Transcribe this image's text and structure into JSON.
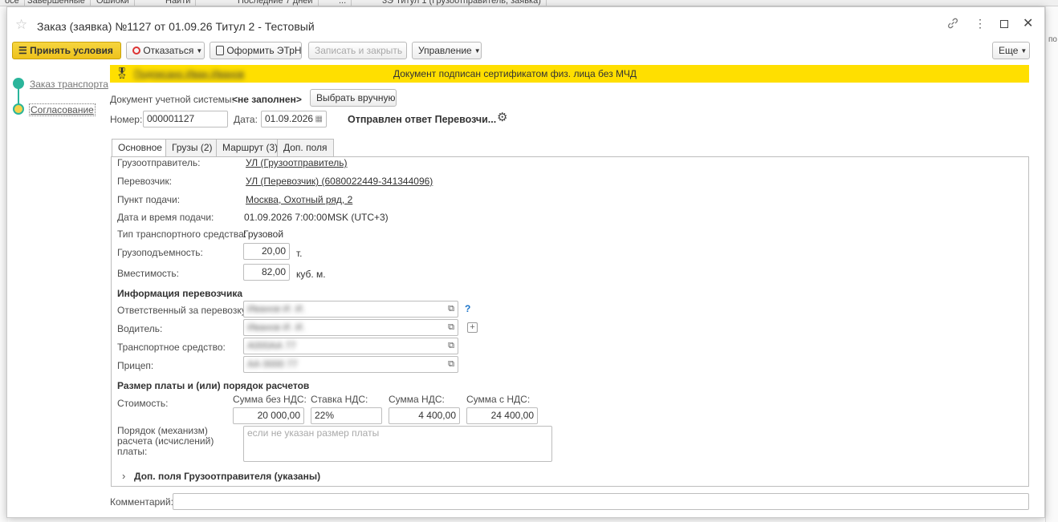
{
  "background": {
    "tabs": [
      "осе",
      "Завершенные",
      "Ошибки",
      "Найти",
      "Последние 7 дней",
      "...",
      "3Э Титул 1 (Грузоотправитель, заявка)"
    ],
    "right_fragment": "по"
  },
  "window": {
    "title": "Заказ (заявка) №1127 от 01.09.26 Титул 2 - Тестовый",
    "icons": [
      "star-icon",
      "link-icon",
      "more-icon",
      "maximize-icon",
      "close-icon"
    ]
  },
  "toolbar": {
    "accept": "Принять условия",
    "decline": "Отказаться",
    "etrn": "Оформить ЭТрН",
    "save_close": "Записать и закрыть",
    "manage": "Управление",
    "more": "Еще"
  },
  "steps": [
    {
      "label": "Заказ транспорта",
      "color": "#2bb59b"
    },
    {
      "label": "Согласование",
      "color": "#f5d24a"
    }
  ],
  "banner": {
    "signer": "Подписано Иван Иванов",
    "text": "Документ подписан сертификатом физ. лица без МЧД",
    "color": "#ffdf00"
  },
  "doc": {
    "label": "Документ учетной системы:",
    "value": "<не заполнен>",
    "button": "Выбрать вручную"
  },
  "header": {
    "number_label": "Номер:",
    "number": "000001127",
    "date_label": "Дата:",
    "date": "01.09.2026",
    "status": "Отправлен ответ Перевозчи..."
  },
  "tabs": [
    "Основное",
    "Грузы (2)",
    "Маршрут (3)",
    "Доп. поля"
  ],
  "main": {
    "shipper_label": "Грузоотправитель:",
    "shipper": "УЛ (Грузоотправитель)",
    "carrier_label": "Перевозчик:",
    "carrier": "УЛ (Перевозчик) (6080022449-341344096)",
    "pickup_label": "Пункт подачи:",
    "pickup": "Москва, Охотный ряд, 2",
    "datetime_label": "Дата и время подачи:",
    "datetime": "01.09.2026 7:00:00",
    "timezone": "MSK (UTC+3)",
    "vehicle_type_label": "Тип транспортного средства:",
    "vehicle_type": "Грузовой",
    "capacity_label": "Грузоподъемность:",
    "capacity": "20,00",
    "capacity_unit": "т.",
    "volume_label": "Вместимость:",
    "volume": "82,00",
    "volume_unit": "куб. м."
  },
  "carrier_info": {
    "title": "Информация перевозчика",
    "responsible_label": "Ответственный за перевозку:",
    "responsible": "Иванов И. И.",
    "help": "?",
    "driver_label": "Водитель:",
    "driver": "Иванов И. И.",
    "vehicle_label": "Транспортное средство:",
    "vehicle": "А000АА 77",
    "trailer_label": "Прицеп:",
    "trailer": "АА 0000 77"
  },
  "payment": {
    "title": "Размер платы и (или) порядок расчетов",
    "cost_label": "Стоимость:",
    "col_sum_no_vat": "Сумма без НДС:",
    "col_rate": "Ставка НДС:",
    "col_vat": "Сумма НДС:",
    "col_sum_vat": "Сумма с НДС:",
    "sum_no_vat": "20 000,00",
    "rate": "22%",
    "vat": "4 400,00",
    "sum_vat": "24 400,00",
    "order_label": "Порядок (механизм) расчета (исчислений) платы:",
    "order_placeholder": "если не указан размер платы"
  },
  "extra": {
    "title": "Доп. поля Грузоотправителя (указаны)"
  },
  "comment": {
    "label": "Комментарий:"
  }
}
